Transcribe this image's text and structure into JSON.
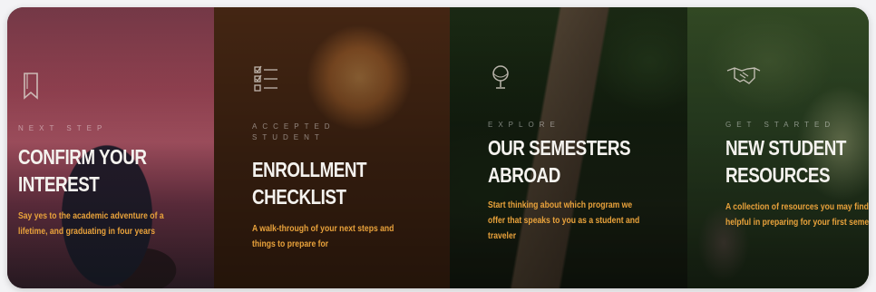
{
  "cards": [
    {
      "icon": "bookmark-icon",
      "kicker": "NEXT STEP",
      "title": "CONFIRM YOUR INTEREST",
      "description": "Say yes to the academic adventure of a lifetime, and graduating in four years"
    },
    {
      "icon": "checklist-icon",
      "kicker": "ACCEPTED STUDENT",
      "title": "ENROLLMENT CHECKLIST",
      "description": "A walk-through of your next steps and things to prepare for"
    },
    {
      "icon": "globe-icon",
      "kicker": "EXPLORE",
      "title": "OUR SEMESTERS ABROAD",
      "description": "Start thinking about which program we offer that speaks to you as a student and traveler"
    },
    {
      "icon": "handshake-icon",
      "kicker": "GET STARTED",
      "title": "NEW STUDENT RESOURCES",
      "description": "A collection of resources you may find helpful in preparing for your first semester"
    }
  ],
  "colors": {
    "title": "#f4f2ee",
    "description": "#e9a23b"
  }
}
